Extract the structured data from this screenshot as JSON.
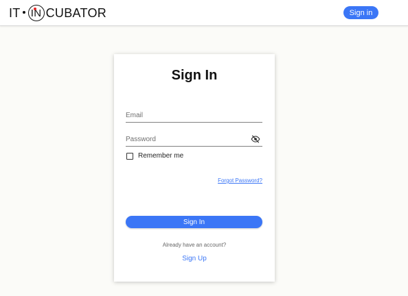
{
  "header": {
    "logo": {
      "prefix": "IT",
      "circle_letters": "IN",
      "suffix": "CUBATOR"
    },
    "signin_button": "Sign in"
  },
  "card": {
    "title": "Sign In",
    "email": {
      "placeholder": "Email",
      "value": ""
    },
    "password": {
      "placeholder": "Password",
      "value": ""
    },
    "remember_label": "Remember me",
    "remember_checked": false,
    "forgot_link": "Forgot Password?",
    "submit_button": "Sign In",
    "already_text": "Already have an account?",
    "signup_link": "Sign Up"
  },
  "colors": {
    "accent": "#3b76f6",
    "logo_red": "#e02424",
    "page_bg": "#fbfbf8"
  },
  "icons": {
    "password_toggle": "eye-off-icon",
    "logo_mark": "logo-dot-icon"
  }
}
